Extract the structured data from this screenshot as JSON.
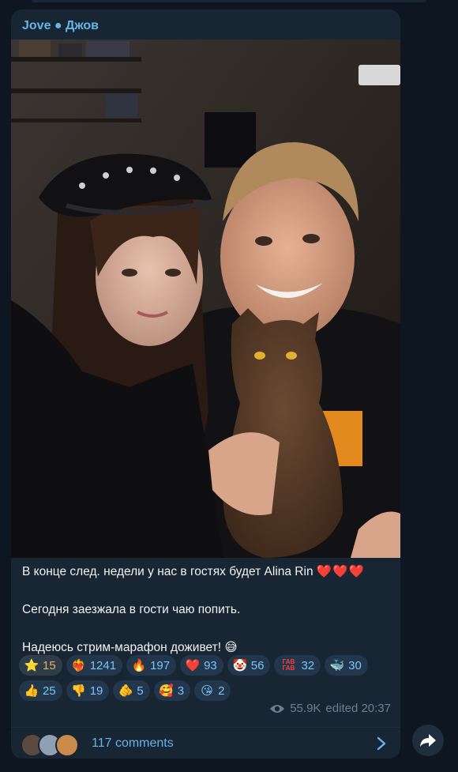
{
  "message": {
    "author": "Jove ● Джов",
    "lines": [
      "В конце след. недели у нас в гостях будет Alina Rin",
      "Сегодня заезжала в гости чаю попить.",
      "Надеюсь стрим-марафон доживет!"
    ],
    "line1_emoji": "❤️❤️❤️",
    "line3_emoji": "😅",
    "reactions": [
      {
        "emoji": "⭐",
        "count": "15",
        "icon": "star-icon"
      },
      {
        "emoji": "❤️‍🔥",
        "count": "1241",
        "icon": "heart-on-fire-icon"
      },
      {
        "emoji": "🔥",
        "count": "197",
        "icon": "fire-icon"
      },
      {
        "emoji": "❤️",
        "count": "93",
        "icon": "heart-icon"
      },
      {
        "emoji": "🤡",
        "count": "56",
        "icon": "clown-icon"
      },
      {
        "emoji": "ГАВ ГАВ",
        "count": "32",
        "icon": "gav-gav-sticker-icon"
      },
      {
        "emoji": "🐳",
        "count": "30",
        "icon": "whale-icon"
      },
      {
        "emoji": "👍",
        "count": "25",
        "icon": "thumbs-up-icon"
      },
      {
        "emoji": "👎",
        "count": "19",
        "icon": "thumbs-down-icon"
      },
      {
        "emoji": "🫵",
        "count": "5",
        "icon": "pointing-hand-icon"
      },
      {
        "emoji": "🥰",
        "count": "3",
        "icon": "smiling-hearts-icon"
      },
      {
        "emoji": "😘",
        "count": "2",
        "icon": "kiss-icon"
      }
    ],
    "views": "55.9K",
    "edited": "edited 20:37",
    "comments": "117 comments"
  },
  "colors": {
    "background": "#0e1621",
    "bubble": "#182533",
    "accent": "#64b5e8",
    "reaction_bg": "#22374c",
    "selected_reaction_text": "#e0b060"
  }
}
